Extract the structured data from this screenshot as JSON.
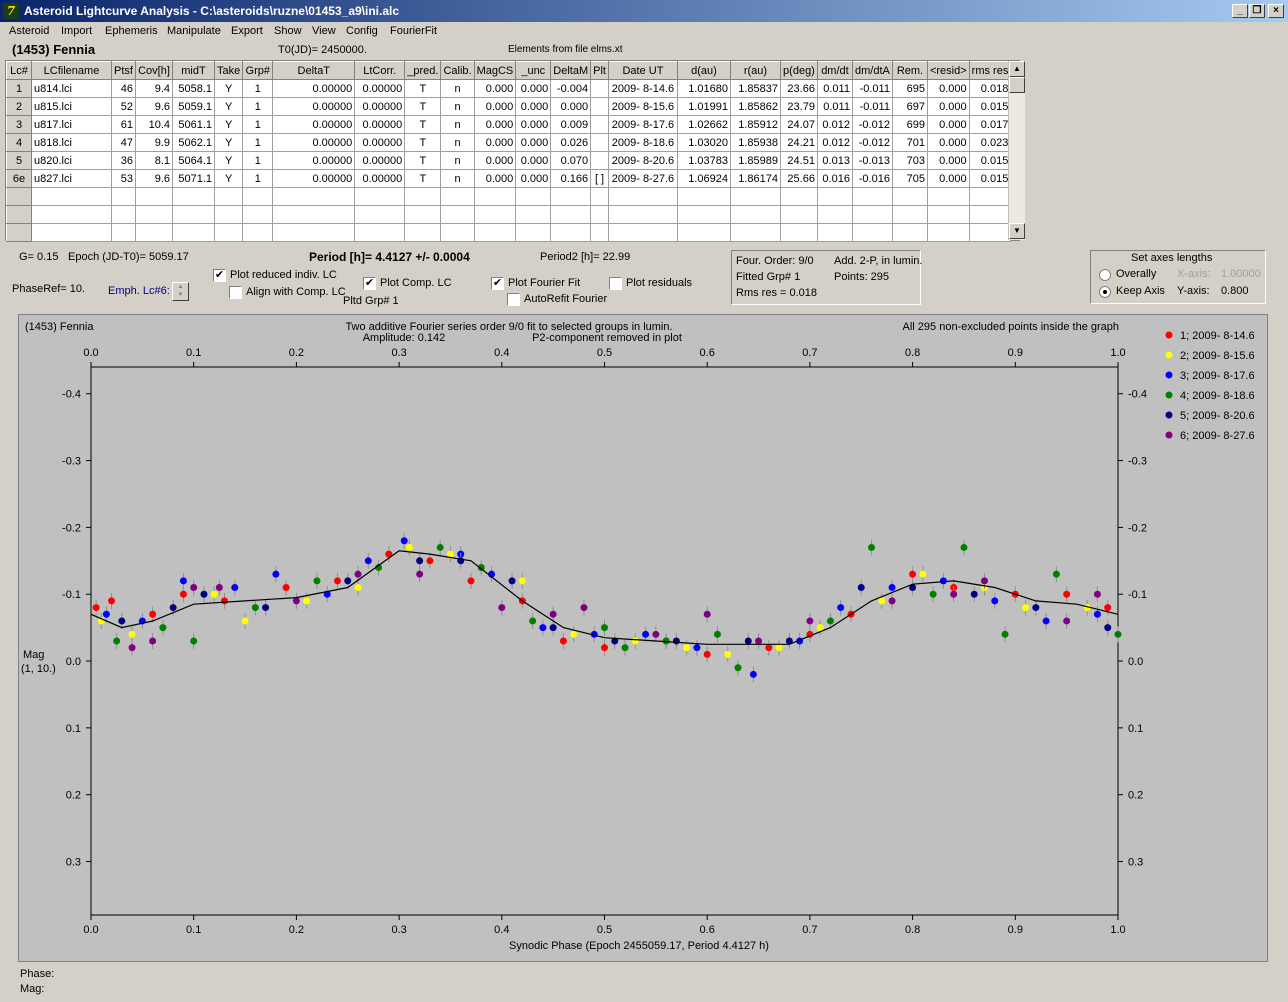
{
  "window": {
    "title": "Asteroid Lightcurve Analysis - C:\\asteroids\\ruzne\\01453_a9\\ini.alc",
    "icon_glyph": "7"
  },
  "menu": [
    "Asteroid",
    "Import",
    "Ephemeris",
    "Manipulate",
    "Export",
    "Show",
    "View",
    "Config",
    "FourierFit"
  ],
  "header": {
    "asteroid": "(1453) Fennia",
    "t0": "T0(JD)= 2450000.",
    "elements": "Elements from file elms.xt"
  },
  "table": {
    "columns": [
      "Lc#",
      "LCfilename",
      "Ptsf",
      "Cov[h]",
      "midT",
      "Take",
      "Grp#",
      "DeltaT",
      "LtCorr.",
      "_pred.",
      "Calib.",
      "MagCS",
      "_unc",
      "DeltaM",
      "Plt",
      "Date UT",
      "d(au)",
      "r(au)",
      "p(deg)",
      "dm/dt",
      "dm/dtA",
      "Rem.",
      "<resid>",
      "rms res"
    ],
    "rows": [
      [
        "1",
        "u814.lci",
        "46",
        "9.4",
        "5058.1",
        "Y",
        "1",
        "0.00000",
        "0.00000",
        "T",
        "n",
        "0.000",
        "0.000",
        "-0.004",
        "",
        "2009- 8-14.6",
        "1.01680",
        "1.85837",
        "23.66",
        "0.011",
        "-0.011",
        "695",
        "0.000",
        "0.018"
      ],
      [
        "2",
        "u815.lci",
        "52",
        "9.6",
        "5059.1",
        "Y",
        "1",
        "0.00000",
        "0.00000",
        "T",
        "n",
        "0.000",
        "0.000",
        "0.000",
        "",
        "2009- 8-15.6",
        "1.01991",
        "1.85862",
        "23.79",
        "0.011",
        "-0.011",
        "697",
        "0.000",
        "0.015"
      ],
      [
        "3",
        "u817.lci",
        "61",
        "10.4",
        "5061.1",
        "Y",
        "1",
        "0.00000",
        "0.00000",
        "T",
        "n",
        "0.000",
        "0.000",
        "0.009",
        "",
        "2009- 8-17.6",
        "1.02662",
        "1.85912",
        "24.07",
        "0.012",
        "-0.012",
        "699",
        "0.000",
        "0.017"
      ],
      [
        "4",
        "u818.lci",
        "47",
        "9.9",
        "5062.1",
        "Y",
        "1",
        "0.00000",
        "0.00000",
        "T",
        "n",
        "0.000",
        "0.000",
        "0.026",
        "",
        "2009- 8-18.6",
        "1.03020",
        "1.85938",
        "24.21",
        "0.012",
        "-0.012",
        "701",
        "0.000",
        "0.023"
      ],
      [
        "5",
        "u820.lci",
        "36",
        "8.1",
        "5064.1",
        "Y",
        "1",
        "0.00000",
        "0.00000",
        "T",
        "n",
        "0.000",
        "0.000",
        "0.070",
        "",
        "2009- 8-20.6",
        "1.03783",
        "1.85989",
        "24.51",
        "0.013",
        "-0.013",
        "703",
        "0.000",
        "0.015"
      ],
      [
        "6e",
        "u827.lci",
        "53",
        "9.6",
        "5071.1",
        "Y",
        "1",
        "0.00000",
        "0.00000",
        "T",
        "n",
        "0.000",
        "0.000",
        "0.166",
        "[ ]",
        "2009- 8-27.6",
        "1.06924",
        "1.86174",
        "25.66",
        "0.016",
        "-0.016",
        "705",
        "0.000",
        "0.015"
      ]
    ]
  },
  "controls": {
    "g": "G= 0.15",
    "epoch": "Epoch (JD-T0)= 5059.17",
    "period": "Period [h]= 4.4127 +/- 0.0004",
    "period2": "Period2 [h]= 22.99",
    "phaseref": "PhaseRef= 10.",
    "emph": "Emph. Lc#6:",
    "plot_reduced": "Plot reduced indiv. LC",
    "align_comp": "Align with Comp. LC",
    "plot_comp": "Plot Comp. LC",
    "pltd_grp": "Pltd Grp#  1",
    "plot_fourier": "Plot Fourier Fit",
    "autorefit": "AutoRefit Fourier",
    "plot_residuals": "Plot residuals",
    "four_order": "Four. Order:  9/0",
    "add2p": "Add. 2-P, in lumin.",
    "fitted_grp": "Fitted Grp# 1",
    "points": "Points: 295",
    "rms": "Rms res     = 0.018",
    "axes_title": "Set axes lengths",
    "overally": "Overally",
    "keep_axis": "Keep Axis",
    "xaxis_label": "X-axis:",
    "xaxis_val": "1.00000",
    "yaxis_label": "Y-axis:",
    "yaxis_val": "0.800",
    "checked": {
      "plot_reduced": true,
      "align_comp": false,
      "plot_comp": true,
      "plot_fourier": true,
      "autorefit": false,
      "plot_residuals": false,
      "keep_axis": true
    }
  },
  "status": {
    "phase": "Phase:",
    "mag": "Mag:"
  },
  "chart_data": {
    "type": "scatter",
    "title_left": "(1453) Fennia",
    "title_center1": "Two additive Fourier series order 9/0 fit to selected groups in lumin.",
    "title_center2_a": "Amplitude: 0.142",
    "title_center2_b": "P2-component removed in plot",
    "title_right": "All 295 non-excluded points inside the graph",
    "xlabel": "Synodic Phase (Epoch 2455059.17, Period 4.4127 h)",
    "ylabel1": "Mag",
    "ylabel2": "(1, 10.)",
    "xlim": [
      0.0,
      1.0
    ],
    "ylim": [
      -0.4,
      0.4
    ],
    "y_inverted": true,
    "xticks": [
      "0.0",
      "0.1",
      "0.2",
      "0.3",
      "0.4",
      "0.5",
      "0.6",
      "0.7",
      "0.8",
      "0.9",
      "1.0"
    ],
    "yticks": [
      "-0.4",
      "-0.3",
      "-0.2",
      "-0.1",
      "0.0",
      "0.1",
      "0.2",
      "0.3"
    ],
    "legend_position": "top-right",
    "fit_curve": [
      [
        0.0,
        -0.07
      ],
      [
        0.03,
        -0.05
      ],
      [
        0.06,
        -0.06
      ],
      [
        0.1,
        -0.085
      ],
      [
        0.15,
        -0.09
      ],
      [
        0.2,
        -0.095
      ],
      [
        0.25,
        -0.11
      ],
      [
        0.3,
        -0.165
      ],
      [
        0.33,
        -0.16
      ],
      [
        0.37,
        -0.15
      ],
      [
        0.42,
        -0.09
      ],
      [
        0.46,
        -0.05
      ],
      [
        0.5,
        -0.035
      ],
      [
        0.55,
        -0.03
      ],
      [
        0.6,
        -0.025
      ],
      [
        0.65,
        -0.025
      ],
      [
        0.68,
        -0.025
      ],
      [
        0.72,
        -0.05
      ],
      [
        0.76,
        -0.09
      ],
      [
        0.8,
        -0.115
      ],
      [
        0.84,
        -0.12
      ],
      [
        0.88,
        -0.11
      ],
      [
        0.92,
        -0.09
      ],
      [
        0.96,
        -0.085
      ],
      [
        1.0,
        -0.07
      ]
    ],
    "series": [
      {
        "name": "1; 2009- 8-14.6",
        "color": "#ff0000",
        "points": [
          [
            0.005,
            -0.08
          ],
          [
            0.02,
            -0.09
          ],
          [
            0.06,
            -0.07
          ],
          [
            0.09,
            -0.1
          ],
          [
            0.13,
            -0.09
          ],
          [
            0.19,
            -0.11
          ],
          [
            0.24,
            -0.12
          ],
          [
            0.29,
            -0.16
          ],
          [
            0.33,
            -0.15
          ],
          [
            0.37,
            -0.12
          ],
          [
            0.42,
            -0.09
          ],
          [
            0.46,
            -0.03
          ],
          [
            0.5,
            -0.02
          ],
          [
            0.56,
            -0.03
          ],
          [
            0.6,
            -0.01
          ],
          [
            0.66,
            -0.02
          ],
          [
            0.7,
            -0.04
          ],
          [
            0.74,
            -0.07
          ],
          [
            0.8,
            -0.13
          ],
          [
            0.84,
            -0.11
          ],
          [
            0.9,
            -0.1
          ],
          [
            0.95,
            -0.1
          ],
          [
            0.99,
            -0.08
          ]
        ]
      },
      {
        "name": "2; 2009- 8-15.6",
        "color": "#ffff00",
        "points": [
          [
            0.01,
            -0.06
          ],
          [
            0.04,
            -0.04
          ],
          [
            0.08,
            -0.08
          ],
          [
            0.12,
            -0.1
          ],
          [
            0.15,
            -0.06
          ],
          [
            0.21,
            -0.09
          ],
          [
            0.26,
            -0.11
          ],
          [
            0.31,
            -0.17
          ],
          [
            0.35,
            -0.16
          ],
          [
            0.42,
            -0.12
          ],
          [
            0.47,
            -0.04
          ],
          [
            0.53,
            -0.03
          ],
          [
            0.58,
            -0.02
          ],
          [
            0.62,
            -0.01
          ],
          [
            0.67,
            -0.02
          ],
          [
            0.71,
            -0.05
          ],
          [
            0.77,
            -0.09
          ],
          [
            0.81,
            -0.13
          ],
          [
            0.87,
            -0.11
          ],
          [
            0.91,
            -0.08
          ],
          [
            0.97,
            -0.08
          ]
        ]
      },
      {
        "name": "3; 2009- 8-17.6",
        "color": "#0000ff",
        "points": [
          [
            0.015,
            -0.07
          ],
          [
            0.05,
            -0.06
          ],
          [
            0.09,
            -0.12
          ],
          [
            0.14,
            -0.11
          ],
          [
            0.18,
            -0.13
          ],
          [
            0.23,
            -0.1
          ],
          [
            0.27,
            -0.15
          ],
          [
            0.305,
            -0.18
          ],
          [
            0.36,
            -0.16
          ],
          [
            0.39,
            -0.13
          ],
          [
            0.44,
            -0.05
          ],
          [
            0.49,
            -0.04
          ],
          [
            0.54,
            -0.04
          ],
          [
            0.59,
            -0.02
          ],
          [
            0.645,
            0.02
          ],
          [
            0.69,
            -0.03
          ],
          [
            0.73,
            -0.08
          ],
          [
            0.78,
            -0.11
          ],
          [
            0.83,
            -0.12
          ],
          [
            0.88,
            -0.09
          ],
          [
            0.93,
            -0.06
          ],
          [
            0.98,
            -0.07
          ]
        ]
      },
      {
        "name": "4; 2009- 8-18.6",
        "color": "#008000",
        "points": [
          [
            0.025,
            -0.03
          ],
          [
            0.07,
            -0.05
          ],
          [
            0.1,
            -0.03
          ],
          [
            0.16,
            -0.08
          ],
          [
            0.22,
            -0.12
          ],
          [
            0.28,
            -0.14
          ],
          [
            0.34,
            -0.17
          ],
          [
            0.38,
            -0.14
          ],
          [
            0.43,
            -0.06
          ],
          [
            0.5,
            -0.05
          ],
          [
            0.52,
            -0.02
          ],
          [
            0.56,
            -0.03
          ],
          [
            0.61,
            -0.04
          ],
          [
            0.63,
            0.01
          ],
          [
            0.72,
            -0.06
          ],
          [
            0.76,
            -0.17
          ],
          [
            0.82,
            -0.1
          ],
          [
            0.85,
            -0.17
          ],
          [
            0.89,
            -0.04
          ],
          [
            0.94,
            -0.13
          ],
          [
            1.0,
            -0.04
          ]
        ]
      },
      {
        "name": "5; 2009- 8-20.6",
        "color": "#000080",
        "points": [
          [
            0.03,
            -0.06
          ],
          [
            0.08,
            -0.08
          ],
          [
            0.11,
            -0.1
          ],
          [
            0.17,
            -0.08
          ],
          [
            0.25,
            -0.12
          ],
          [
            0.32,
            -0.15
          ],
          [
            0.36,
            -0.15
          ],
          [
            0.41,
            -0.12
          ],
          [
            0.45,
            -0.05
          ],
          [
            0.51,
            -0.03
          ],
          [
            0.57,
            -0.03
          ],
          [
            0.64,
            -0.03
          ],
          [
            0.68,
            -0.03
          ],
          [
            0.75,
            -0.11
          ],
          [
            0.8,
            -0.11
          ],
          [
            0.86,
            -0.1
          ],
          [
            0.92,
            -0.08
          ],
          [
            0.99,
            -0.05
          ]
        ]
      },
      {
        "name": "6; 2009- 8-27.6",
        "color": "#800080",
        "points": [
          [
            0.04,
            -0.02
          ],
          [
            0.06,
            -0.03
          ],
          [
            0.1,
            -0.11
          ],
          [
            0.125,
            -0.11
          ],
          [
            0.2,
            -0.09
          ],
          [
            0.26,
            -0.13
          ],
          [
            0.32,
            -0.13
          ],
          [
            0.4,
            -0.08
          ],
          [
            0.45,
            -0.07
          ],
          [
            0.48,
            -0.08
          ],
          [
            0.55,
            -0.04
          ],
          [
            0.6,
            -0.07
          ],
          [
            0.65,
            -0.03
          ],
          [
            0.7,
            -0.06
          ],
          [
            0.78,
            -0.09
          ],
          [
            0.84,
            -0.1
          ],
          [
            0.87,
            -0.12
          ],
          [
            0.95,
            -0.06
          ],
          [
            0.98,
            -0.1
          ]
        ]
      }
    ]
  }
}
